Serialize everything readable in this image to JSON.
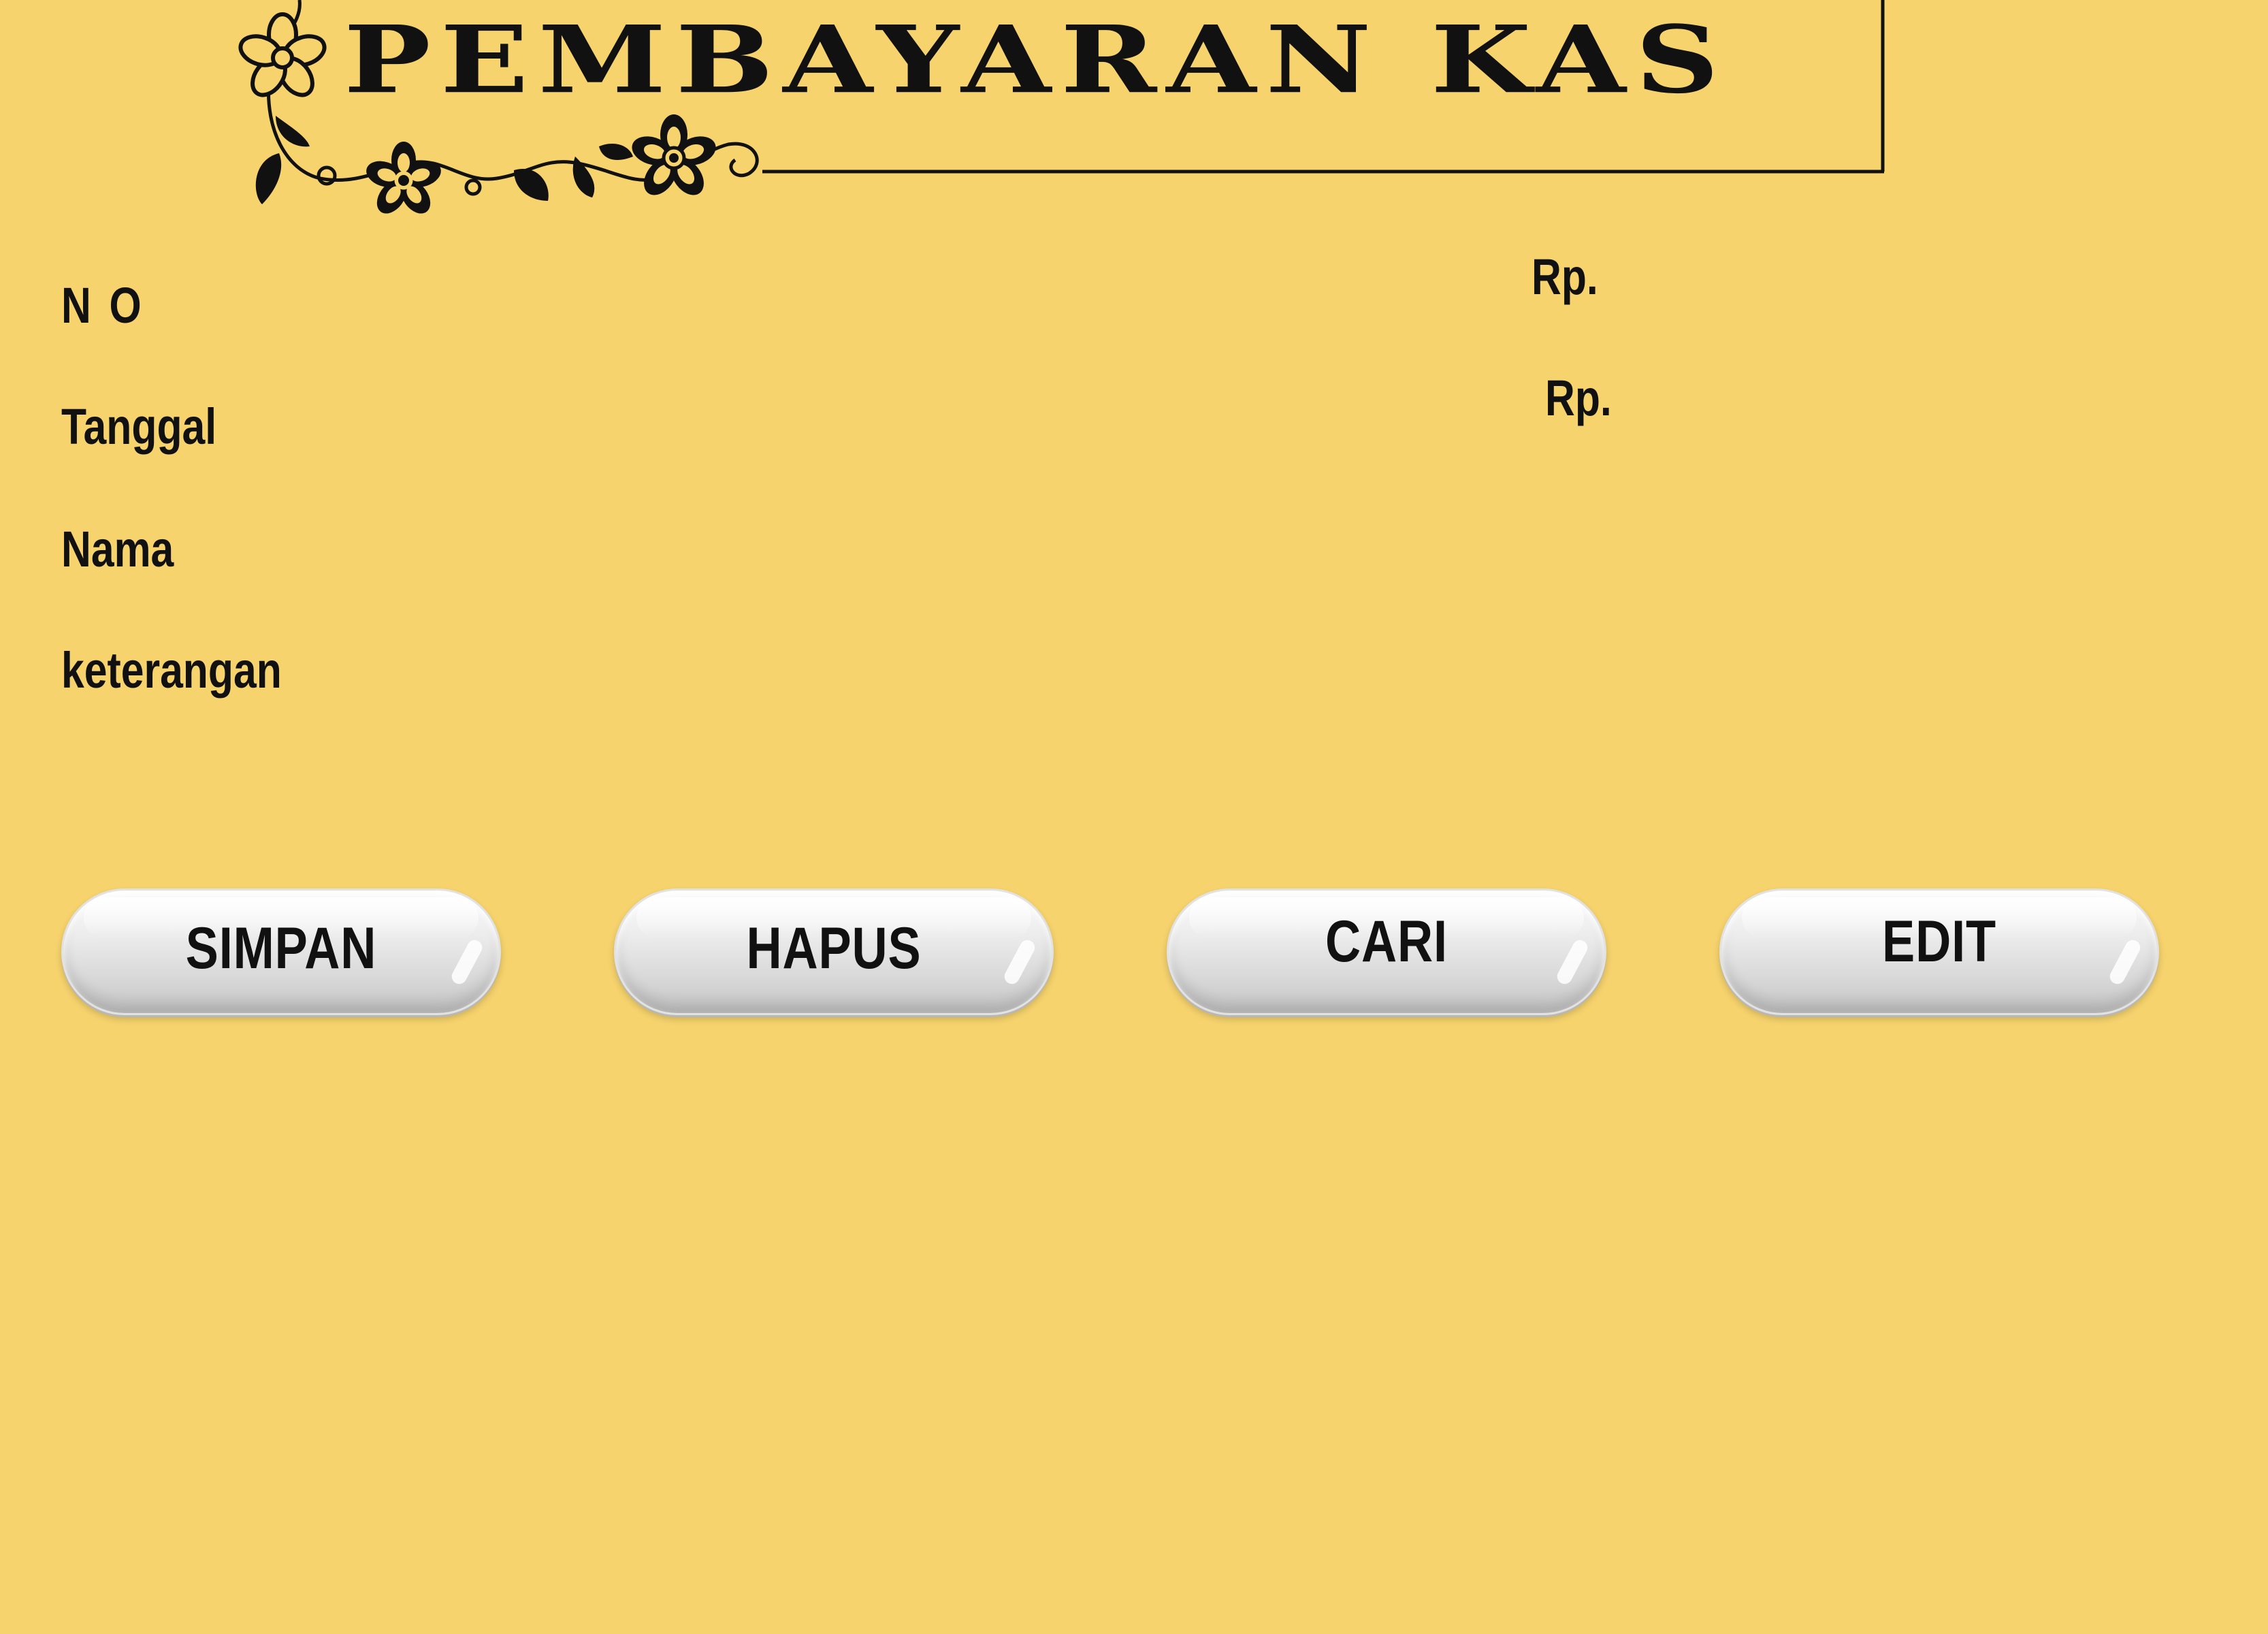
{
  "header": {
    "title": "PEMBAYARAN KAS",
    "ornament_icon": "floral-vine-ornament"
  },
  "form": {
    "fields": [
      {
        "label": "N O"
      },
      {
        "label": "Tanggal"
      },
      {
        "label": "Nama"
      },
      {
        "label": "keterangan"
      }
    ],
    "currency_fields": [
      {
        "label": "Rp."
      },
      {
        "label": "Rp."
      }
    ]
  },
  "buttons": {
    "simpan": "SIMPAN",
    "hapus": "HAPUS",
    "cari": "CARI",
    "edit": "EDIT"
  },
  "colors": {
    "background": "#F6D36D",
    "text": "#111111",
    "button": "#E6E6E6"
  }
}
